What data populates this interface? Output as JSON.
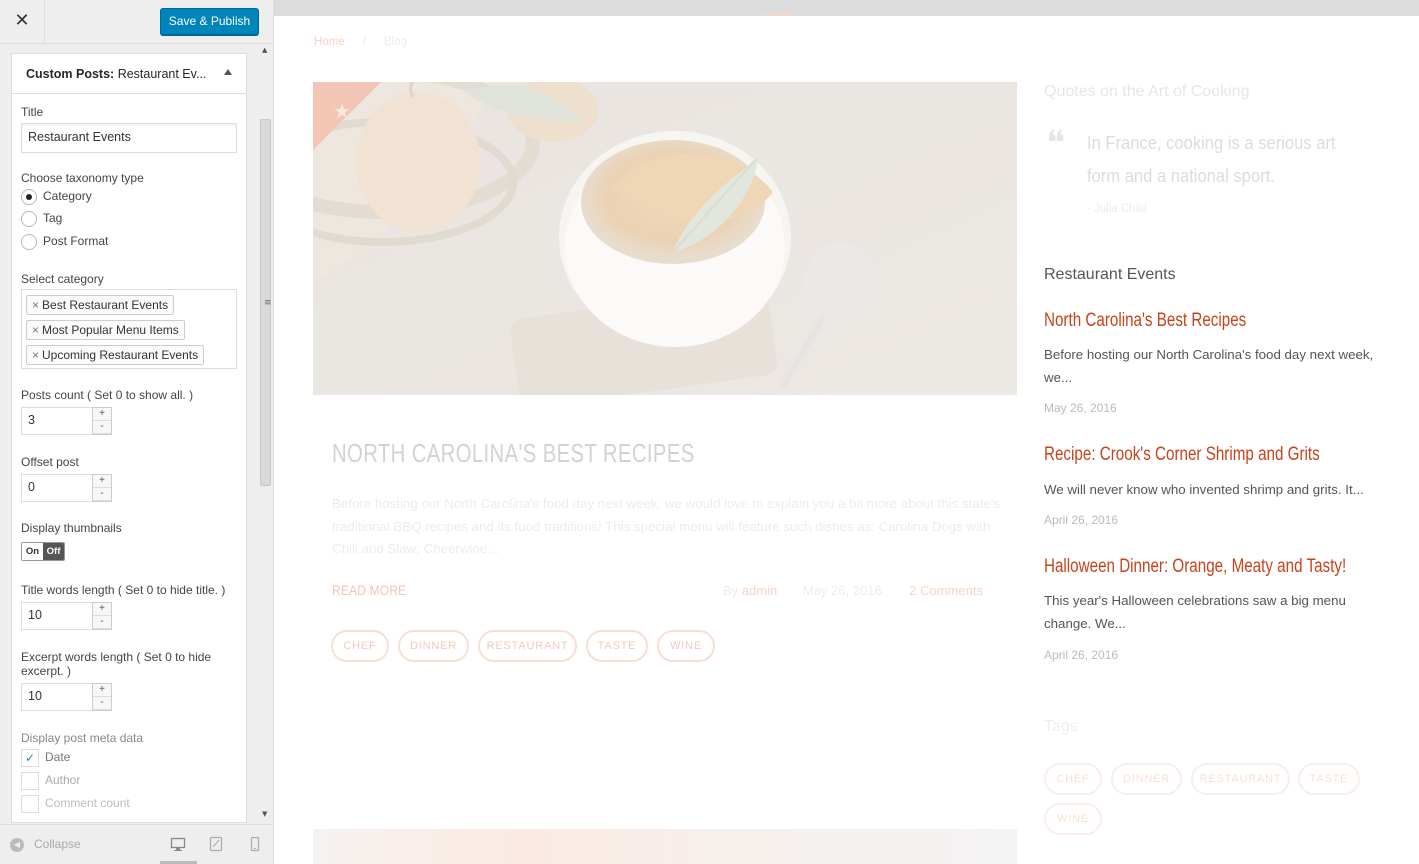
{
  "sidebar": {
    "close_label": "✕",
    "publish_label": "Save & Publish",
    "panel_title_prefix": "Custom Posts:",
    "panel_title": "Restaurant Ev...",
    "title_label": "Title",
    "title_value": "Restaurant Events",
    "taxonomy_label": "Choose taxonomy type",
    "taxonomy_options": [
      {
        "label": "Category",
        "selected": true
      },
      {
        "label": "Tag",
        "selected": false
      },
      {
        "label": "Post Format",
        "selected": false
      }
    ],
    "category_label": "Select category",
    "categories": [
      "Best Restaurant Events",
      "Most Popular Menu Items",
      "Upcoming Restaurant Events"
    ],
    "chip_remove": "×",
    "posts_count_label": "Posts count ( Set 0 to show all. )",
    "posts_count": "3",
    "offset_label": "Offset post",
    "offset": "0",
    "thumbs_label": "Display thumbnails",
    "toggle_on": "On",
    "toggle_off": "Off",
    "title_words_label": "Title words length ( Set 0 to hide title. )",
    "title_words": "10",
    "excerpt_words_label": "Excerpt words length ( Set 0 to hide excerpt. )",
    "excerpt_words": "10",
    "meta_label": "Display post meta data",
    "meta_options": [
      {
        "label": "Date",
        "checked": true
      },
      {
        "label": "Author",
        "checked": false
      },
      {
        "label": "Comment count",
        "checked": false
      }
    ],
    "spin_up": "+",
    "spin_down": "-",
    "collapse_label": "Collapse"
  },
  "preview": {
    "breadcrumb": {
      "home": "Home",
      "sep": "/",
      "current": "Blog"
    },
    "post": {
      "title": "NORTH CAROLINA'S BEST RECIPES",
      "excerpt": "Before hosting our North Carolina's food day next week, we would love to explain you a bit more about this state's traditional BBQ recipes and its food traditions! This special menu will feature such dishes as: Carolina Dogs with Chili and Slaw; Cheerwine...",
      "read_more": "READ MORE",
      "by": "By",
      "author": "admin",
      "date": "May 26, 2016",
      "comments": "2 Comments",
      "tags": [
        "CHEF",
        "DINNER",
        "RESTAURANT",
        "TASTE",
        "WINE"
      ]
    },
    "quotes": {
      "heading": "Quotes on the Art of Cooking",
      "text": "In France, cooking is a serious art form and a national sport.",
      "author": "- Julia Child"
    },
    "events": {
      "heading": "Restaurant Events",
      "items": [
        {
          "title": "North Carolina's Best Recipes",
          "excerpt": "Before hosting our North Carolina's food day next week, we...",
          "date": "May 26, 2016"
        },
        {
          "title": "Recipe: Crook's Corner Shrimp and Grits",
          "excerpt": "We will never know who invented shrimp and grits. It...",
          "date": "April 26, 2016"
        },
        {
          "title": "Halloween Dinner: Orange, Meaty and Tasty!",
          "excerpt": "This year's Halloween celebrations saw a big menu change. We...",
          "date": "April 26, 2016"
        }
      ]
    },
    "tags_widget": {
      "heading": "Tags",
      "tags": [
        "CHEF",
        "DINNER",
        "RESTAURANT",
        "TASTE",
        "WINE"
      ]
    }
  },
  "colors": {
    "accent": "#c8431b",
    "publish": "#0085ba"
  }
}
